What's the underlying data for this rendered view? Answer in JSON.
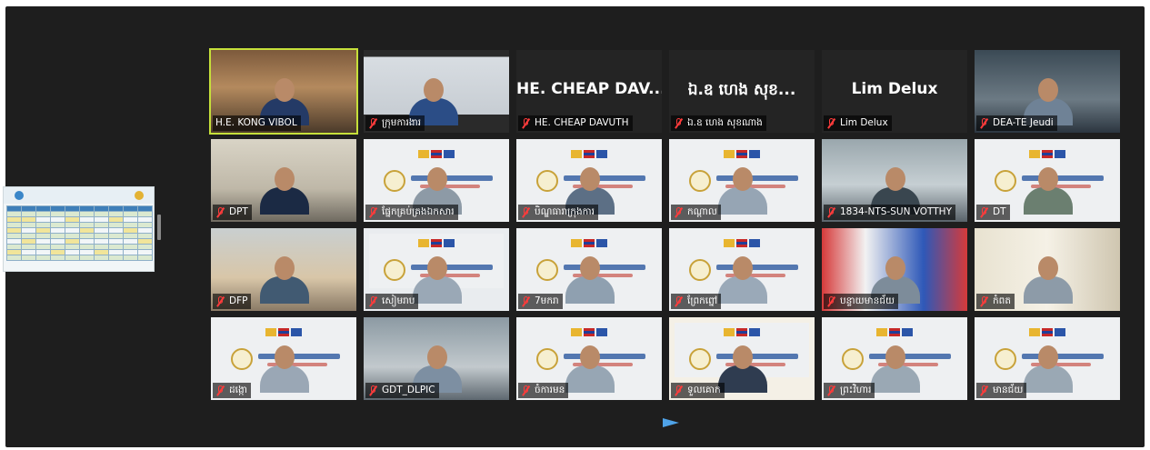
{
  "participants": [
    {
      "name": "H.E. KONG VIBOL",
      "muted": false,
      "active": true,
      "view": "video"
    },
    {
      "name": "ក្រុមការងារ",
      "muted": true,
      "view": "video"
    },
    {
      "name": "HE. CHEAP DAVUTH",
      "big_name": "HE. CHEAP DAV...",
      "muted": true,
      "view": "avatar"
    },
    {
      "name": "ឯ.ឧ ហេង សុខណាង",
      "big_name": "ឯ.ឧ ហេង សុខ...",
      "muted": true,
      "view": "avatar"
    },
    {
      "name": "Lim Delux",
      "big_name": "Lim Delux",
      "muted": true,
      "view": "avatar"
    },
    {
      "name": "DEA-TE Jeudi",
      "muted": true,
      "view": "video"
    },
    {
      "name": "DPT",
      "muted": true,
      "view": "video"
    },
    {
      "name": "ផ្នែកគ្រប់គ្រងឯកសារ",
      "muted": true,
      "view": "video"
    },
    {
      "name": "បិណ្ឌធារាក្រុងការ",
      "muted": true,
      "view": "video"
    },
    {
      "name": "កណ្តាល",
      "muted": true,
      "view": "video"
    },
    {
      "name": "1834-NTS-SUN VOTTHY",
      "muted": true,
      "view": "video"
    },
    {
      "name": "DT",
      "muted": true,
      "view": "video"
    },
    {
      "name": "DFP",
      "muted": true,
      "view": "video"
    },
    {
      "name": "សៀមរាប",
      "muted": true,
      "view": "video"
    },
    {
      "name": "7មករា",
      "muted": true,
      "view": "video"
    },
    {
      "name": "ព្រែកព្នៅ",
      "muted": true,
      "view": "video"
    },
    {
      "name": "បន្ទាយមានជ័យ",
      "muted": true,
      "view": "video"
    },
    {
      "name": "កំពត",
      "muted": true,
      "view": "video"
    },
    {
      "name": "ដង្កោ",
      "muted": true,
      "view": "video"
    },
    {
      "name": "GDT_DLPIC",
      "muted": true,
      "view": "video"
    },
    {
      "name": "ចំការមន",
      "muted": true,
      "view": "video"
    },
    {
      "name": "ទួលគោក",
      "muted": true,
      "view": "video"
    },
    {
      "name": "ព្រះវិហារ",
      "muted": true,
      "view": "video"
    },
    {
      "name": "មានជ័យ",
      "muted": true,
      "view": "video"
    }
  ],
  "colors": {
    "active_border": "#c6e03a",
    "mute_icon": "#ff3b3b",
    "pager_arrow": "#4fa3e8",
    "background": "#1e1e1e"
  }
}
